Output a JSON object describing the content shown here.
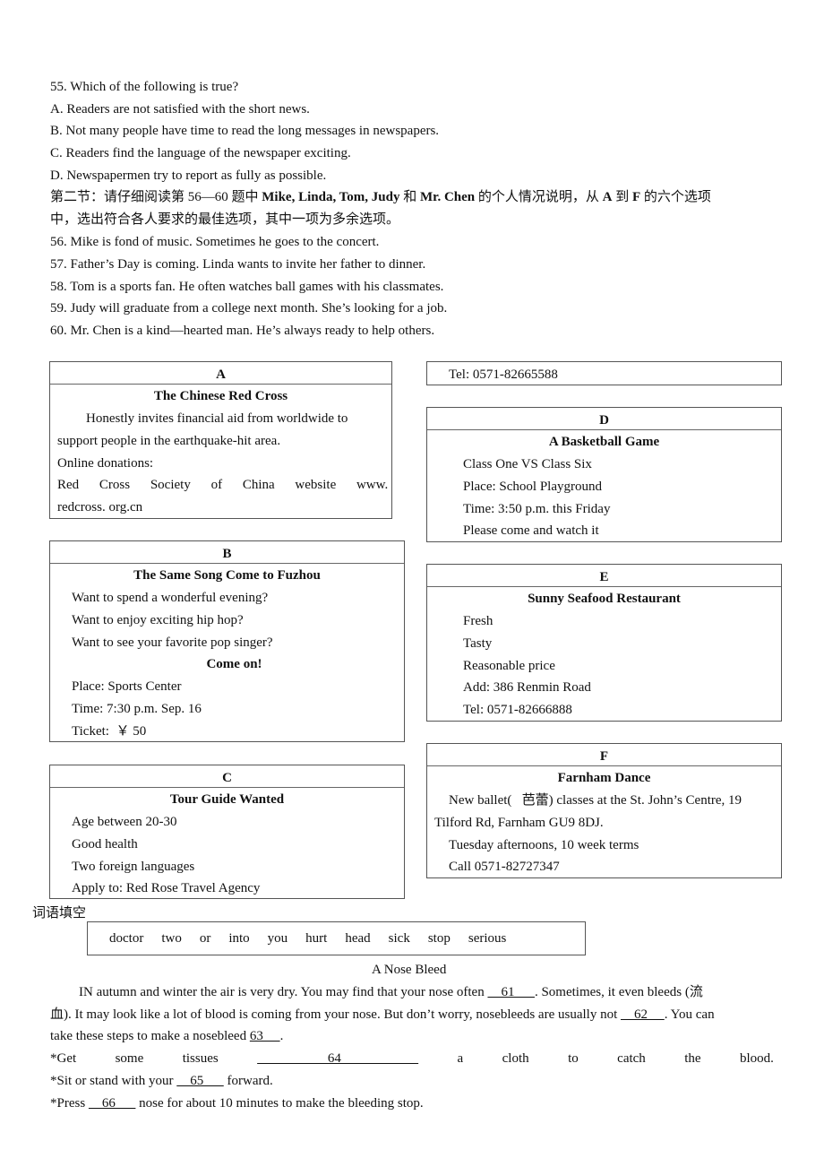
{
  "q55": {
    "question": "55. Which of the following is true?",
    "options": [
      "A. Readers are not satisfied with the short news.",
      "B. Not many people have time to read the long messages in newspapers.",
      "C. Readers find the language of the newspaper exciting.",
      "D. Newspapermen try to report as fully as possible."
    ]
  },
  "section2": {
    "instr_part1": "第二节：请仔细阅读第 56—60 题中 ",
    "instr_bold1": "Mike, Linda, Tom, Judy",
    "instr_part2": " 和 ",
    "instr_bold2": "Mr. Chen",
    "instr_part3": " 的个人情况说明，从 ",
    "instr_bold3": "A",
    "instr_part4": " 到 ",
    "instr_bold4": "F",
    "instr_part5": " 的六个选项",
    "instr_line2": "中，选出符合各人要求的最佳选项，其中一项为多余选项。",
    "items": [
      "56. Mike is fond of music. Sometimes he goes to the concert.",
      "57. Father’s Day is coming. Linda wants to invite her father to dinner.",
      "58. Tom is a sports fan. He often watches ball games with his classmates.",
      "59. Judy will graduate from a college next month. She’s looking for a job.",
      "60. Mr. Chen is a kind—hearted man. He’s always ready to help others."
    ]
  },
  "ads": {
    "A": {
      "letter": "A",
      "title": "The Chinese Red Cross",
      "lines": [
        "Honestly invites financial aid from worldwide to",
        "support people in the earthquake-hit area.",
        "Online donations:",
        "Red Cross Society of China website www.",
        "redcross. org.cn"
      ],
      "continued_tel": "Tel: 0571-82665588"
    },
    "B": {
      "letter": "B",
      "title": "The Same Song Come to Fuzhou",
      "lines": [
        "Want to spend a wonderful evening?",
        "Want to enjoy exciting hip hop?",
        "Want to see your favorite pop singer?"
      ],
      "subtitle": "Come on!",
      "details": [
        "Place: Sports Center",
        "Time: 7:30 p.m. Sep. 16",
        "Ticket:  ￥ 50"
      ]
    },
    "C": {
      "letter": "C",
      "title": "Tour Guide Wanted",
      "lines": [
        "Age between 20-30",
        "Good health",
        "Two foreign languages",
        "Apply to: Red Rose Travel Agency"
      ]
    },
    "D": {
      "letter": "D",
      "title": "A Basketball Game",
      "lines": [
        "Class One VS Class Six",
        "Place: School Playground",
        "Time: 3:50 p.m. this Friday",
        "Please come and watch it"
      ]
    },
    "E": {
      "letter": "E",
      "title": "Sunny Seafood Restaurant",
      "lines": [
        "Fresh",
        "Tasty",
        "Reasonable price",
        "Add: 386 Renmin Road",
        "Tel: 0571-82666888"
      ]
    },
    "F": {
      "letter": "F",
      "title": "Farnham Dance",
      "lines": [
        "New ballet(   芭蕾) classes at the St. John’s Centre, 19",
        "Tilford Rd, Farnham GU9 8DJ.",
        "Tuesday afternoons, 10 week terms",
        "Call 0571-82727347"
      ]
    }
  },
  "cloze": {
    "heading": "词语填空",
    "word_bank": [
      "doctor",
      "two",
      "or",
      "into",
      "you",
      "hurt",
      "head",
      "sick",
      "stop",
      "serious"
    ],
    "title": "A Nose Bleed",
    "p1_a": "IN autumn and winter the air is very dry. You may find that your nose often ",
    "b61": "    61      ",
    "p1_b": ". Sometimes, it even bleeds (流",
    "p2_a": "血). It may look like a lot of blood is coming from your nose. But don’t worry, nosebleeds are usually not ",
    "b62": "    62     ",
    "p2_b": ". You can",
    "p3_a": "take these steps to make a nosebleed ",
    "b63": "63     ",
    "p3_b": ".",
    "step1_words_pre": [
      "*Get",
      "some",
      "tissues"
    ],
    "b64": "                     64                       ",
    "step1_words_post": [
      "a",
      "cloth",
      "to",
      "catch",
      "the",
      "blood."
    ],
    "step2_a": "*Sit or stand with your ",
    "b65": "    65      ",
    "step2_b": " forward.",
    "step3_a": "*Press ",
    "b66": "    66      ",
    "step3_b": " nose for about 10 minutes to make the bleeding stop."
  }
}
